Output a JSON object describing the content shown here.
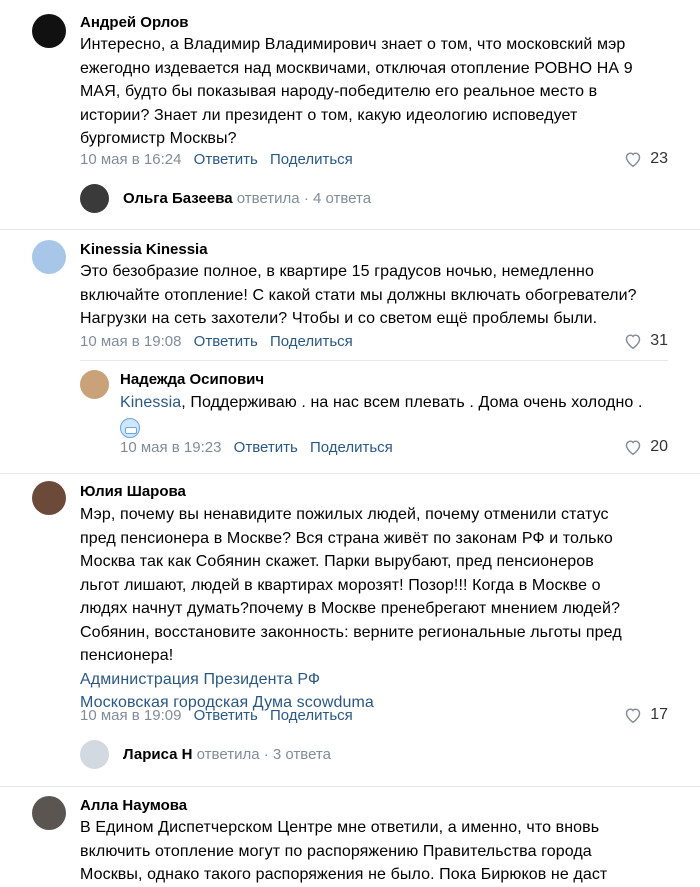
{
  "comments": [
    {
      "author": "Андрей Орлов",
      "lines": [
        "Интересно, а Владимир Владимирович знает о том, что московский мэр",
        "ежегодно издевается над москвичами, отключая отопление РОВНО НА 9",
        "МАЯ, будто бы показывая народу-победителю его реальное место в",
        "истории? Знает ли президент о том, какую идеологию исповедует",
        "бургомистр Москвы?"
      ],
      "date": "10 мая в 16:24",
      "reply_label": "Ответить",
      "share_label": "Поделиться",
      "likes": "23",
      "thread": {
        "author": "Ольга Базеева",
        "verb": "ответила",
        "sep": "·",
        "count": "4 ответа"
      }
    },
    {
      "author": "Kinessia Kinessia",
      "lines": [
        "Это безобразие полное, в квартире 15 градусов ночью, немедленно",
        "включайте отопление! С какой стати мы должны включать обогреватели?",
        "Нагрузки на сеть захотели? Чтобы и со светом ещё проблемы были."
      ],
      "date": "10 мая в 19:08",
      "reply_label": "Ответить",
      "share_label": "Поделиться",
      "likes": "31"
    },
    {
      "author": "Надежда Осипович",
      "mention": "Kinessia",
      "text": ", Поддерживаю . на нас всем плевать . Дома очень холодно .",
      "date": "10 мая в 19:23",
      "reply_label": "Ответить",
      "share_label": "Поделиться",
      "likes": "20"
    },
    {
      "author": "Юлия Шарова",
      "lines": [
        "Мэр, почему вы ненавидите пожилых людей, почему отменили статус",
        "пред пенсионера в Москве? Вся страна живёт по законам РФ и только",
        "Москва так как Собянин скажет. Парки вырубают, пред пенсионеров",
        "льгот лишают, людей в квартирах морозят! Позор!!! Когда в Москве о",
        "людях начнут думать?почему в Москве пренебрегают мнением людей?",
        "Собянин, восстановите законность: верните региональные льготы пред",
        "пенсионера!"
      ],
      "links": [
        "Администрация Президента РФ",
        "Московская городская Дума scowduma"
      ],
      "date": "10 мая в 19:09",
      "reply_label": "Ответить",
      "share_label": "Поделиться",
      "likes": "17",
      "thread": {
        "author": "Лариса Н",
        "verb": "ответила",
        "sep": "·",
        "count": "3 ответа"
      }
    },
    {
      "author": "Алла Наумова",
      "lines": [
        "В Едином Диспетчерском Центре мне ответили, а именно, что вновь",
        "включить отопление могут по распоряжению Правительства города",
        "Москвы, однако такого распоряжения не было. Пока Бирюков не даст"
      ]
    }
  ]
}
